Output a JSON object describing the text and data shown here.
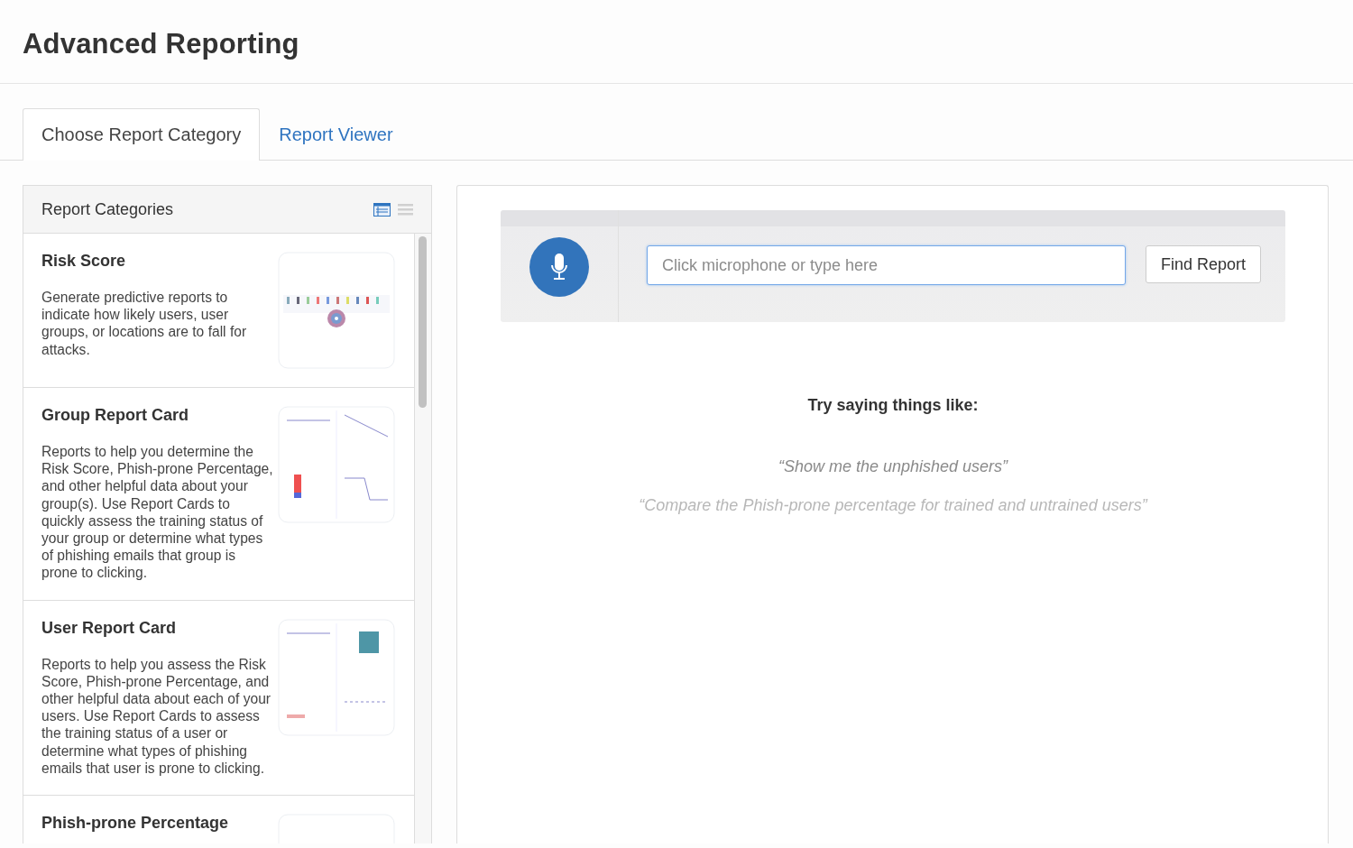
{
  "page": {
    "title": "Advanced Reporting"
  },
  "tabs": [
    {
      "label": "Choose Report Category",
      "selected": true
    },
    {
      "label": "Report Viewer",
      "selected": false
    }
  ],
  "categories_panel": {
    "title": "Report Categories",
    "view_modes": [
      {
        "kind": "cards",
        "selected": true
      },
      {
        "kind": "list",
        "selected": false
      }
    ],
    "items": [
      {
        "title": "Risk Score",
        "description": "Generate predictive reports to indicate how likely users, user groups, or locations are to fall for attacks.",
        "thumbnail": {
          "kind": "single"
        }
      },
      {
        "title": "Group Report Card",
        "description": "Reports to help you determine the Risk Score, Phish-prone Percentage, and other helpful data about your group(s). Use Report Cards to quickly assess the training status of your group or determine what types of phishing emails that group is prone to clicking.",
        "thumbnail": {
          "kind": "grid"
        }
      },
      {
        "title": "User Report Card",
        "description": "Reports to help you assess the Risk Score, Phish-prone Percentage, and other helpful data about each of your users. Use Report Cards to assess the training status of a user or determine what types of phishing emails that user is prone to clicking.",
        "thumbnail": {
          "kind": "grid2"
        }
      },
      {
        "title": "Phish-prone Percentage",
        "thumbnail": {
          "kind": "blank"
        }
      }
    ]
  },
  "search": {
    "placeholder": "Click microphone or type here",
    "button": "Find Report"
  },
  "suggestions": {
    "heading": "Try saying things like:",
    "examples": [
      {
        "text": "“Show me the unphished users”",
        "faded": false
      },
      {
        "text": "“Compare the Phish-prone percentage for trained and untrained users”",
        "faded": true
      }
    ]
  }
}
